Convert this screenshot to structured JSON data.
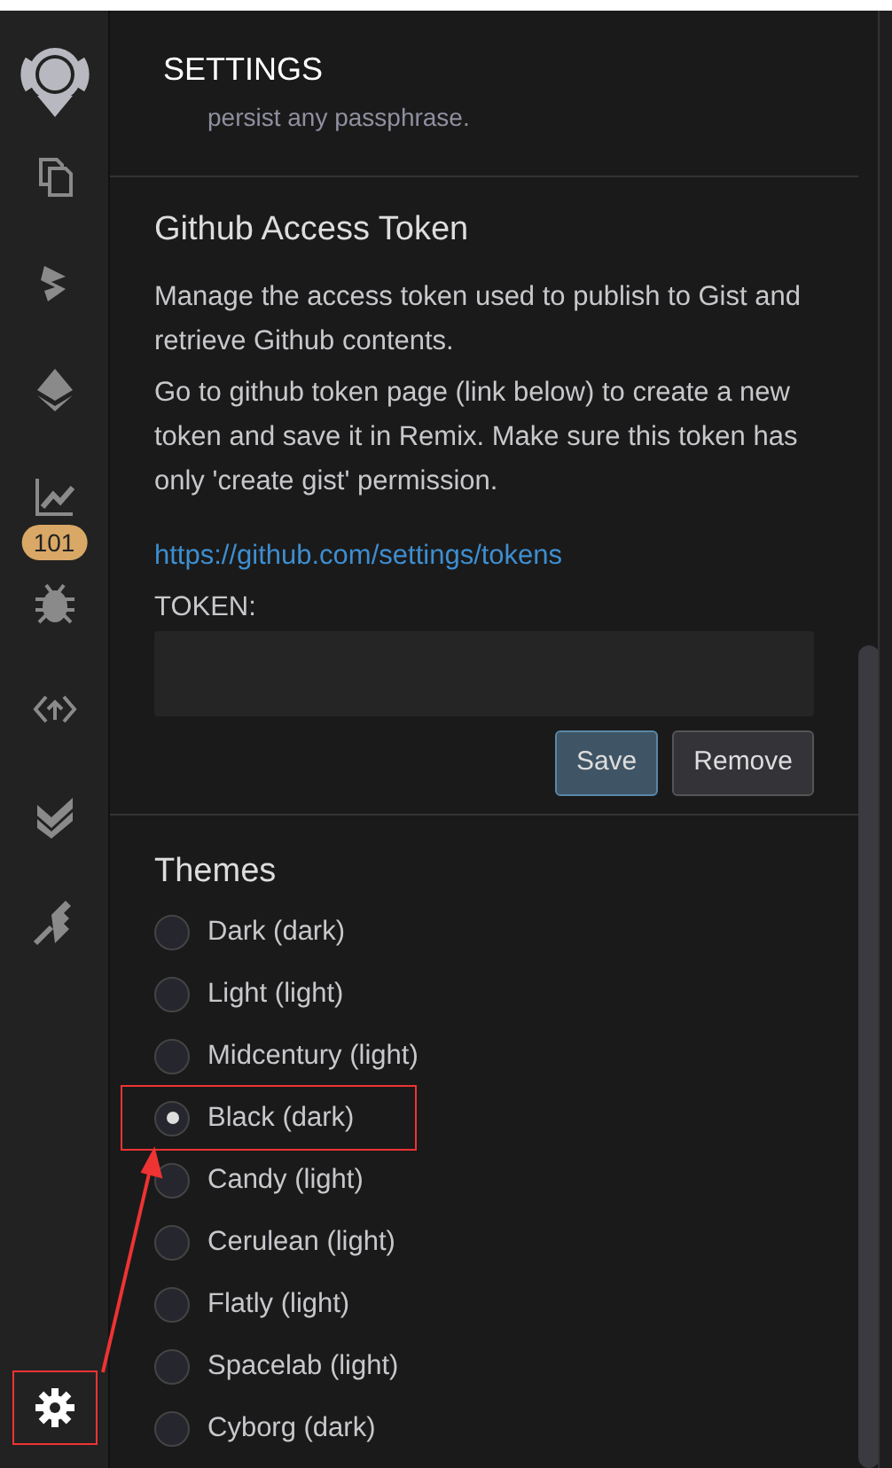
{
  "sidebar": {
    "items": [
      {
        "kind": "files",
        "selected": false
      },
      {
        "kind": "compile",
        "selected": false
      },
      {
        "kind": "deploy",
        "selected": false
      },
      {
        "kind": "analysis",
        "selected": false,
        "badge": "101"
      },
      {
        "kind": "debug",
        "selected": false
      },
      {
        "kind": "udapp",
        "selected": false
      },
      {
        "kind": "tests",
        "selected": false
      },
      {
        "kind": "plugins",
        "selected": false
      }
    ],
    "settings": {
      "selected": true,
      "highlighted": true
    }
  },
  "panel": {
    "title": "SETTINGS",
    "cut_text": "persist any passphrase.",
    "github": {
      "title": "Github Access Token",
      "paragraphs": [
        "Manage the access token used to publish to Gist and retrieve Github contents.",
        "Go to github token page (link below) to create a new token and save it in Remix. Make sure this token has only 'create gist' permission."
      ],
      "link": "https://github.com/settings/tokens",
      "token_label": "TOKEN:",
      "buttons": [
        "Save",
        "Remove"
      ]
    },
    "themes": {
      "title": "Themes",
      "items": [
        {
          "label": "Dark (dark)",
          "selected": false,
          "highlighted": false
        },
        {
          "label": "Light (light)",
          "selected": false,
          "highlighted": false
        },
        {
          "label": "Midcentury (light)",
          "selected": false,
          "highlighted": false
        },
        {
          "label": "Black (dark)",
          "selected": true,
          "highlighted": true
        },
        {
          "label": "Candy (light)",
          "selected": false,
          "highlighted": false
        },
        {
          "label": "Cerulean (light)",
          "selected": false,
          "highlighted": false
        },
        {
          "label": "Flatly (light)",
          "selected": false,
          "highlighted": false
        },
        {
          "label": "Spacelab (light)",
          "selected": false,
          "highlighted": false
        },
        {
          "label": "Cyborg (dark)",
          "selected": false,
          "highlighted": false
        }
      ]
    }
  }
}
